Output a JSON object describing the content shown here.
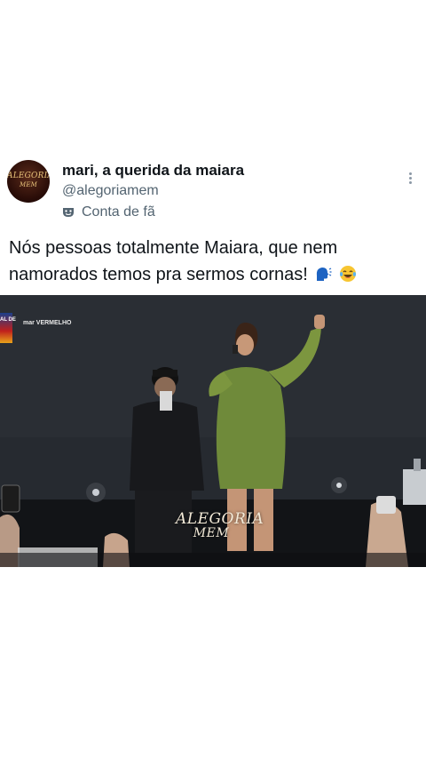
{
  "tweet": {
    "display_name": "mari, a querida da maiara",
    "handle": "@alegoriamem",
    "label": "Conta de fã",
    "text": "Nós pessoas totalmente Maiara, que nem namorados temos pra sermos cornas!",
    "emojis": [
      "speaking-head-emoji",
      "laughing-tears-emoji"
    ]
  },
  "avatar": {
    "logo_line1": "ALEGORIA",
    "logo_line2": "MEM"
  },
  "media": {
    "watermark_line1": "ALEGORIA",
    "watermark_line2": "MEM",
    "stage_logo_left": "AL DE",
    "stage_logo": "mar VERMELHO"
  },
  "colors": {
    "text_primary": "#0f1419",
    "text_secondary": "#536471",
    "dress_green": "#6f8a3a",
    "stage_dark": "#1d2026"
  }
}
